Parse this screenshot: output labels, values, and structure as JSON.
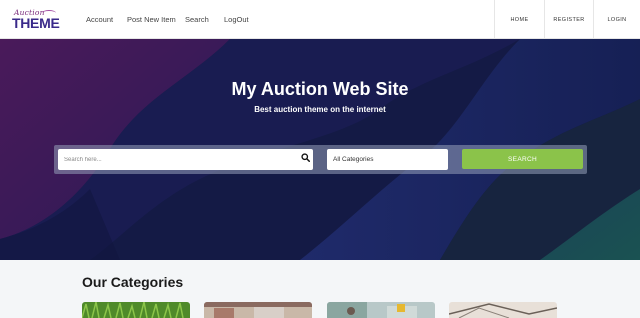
{
  "header": {
    "logo": {
      "top_text": "Auction",
      "main_text": "THEME"
    },
    "nav": [
      {
        "label": "Account"
      },
      {
        "label": "Post New Item"
      },
      {
        "label": "Search"
      },
      {
        "label": "LogOut"
      }
    ],
    "right_nav": [
      {
        "label": "HOME"
      },
      {
        "label": "REGISTER"
      },
      {
        "label": "LOGIN"
      }
    ]
  },
  "hero": {
    "title": "My Auction Web Site",
    "subtitle": "Best auction theme on the internet",
    "search": {
      "placeholder": "Search here...",
      "category_value": "All Categories",
      "button_label": "SEARCH"
    }
  },
  "categories": {
    "title": "Our Categories",
    "items": [
      {
        "icon": "category-image-grass"
      },
      {
        "icon": "category-image-interior"
      },
      {
        "icon": "category-image-office"
      },
      {
        "icon": "category-image-furniture"
      }
    ]
  },
  "colors": {
    "accent": "#8bc34a",
    "hero_dark": "#141a45",
    "brand_purple": "#3a2a8a"
  }
}
